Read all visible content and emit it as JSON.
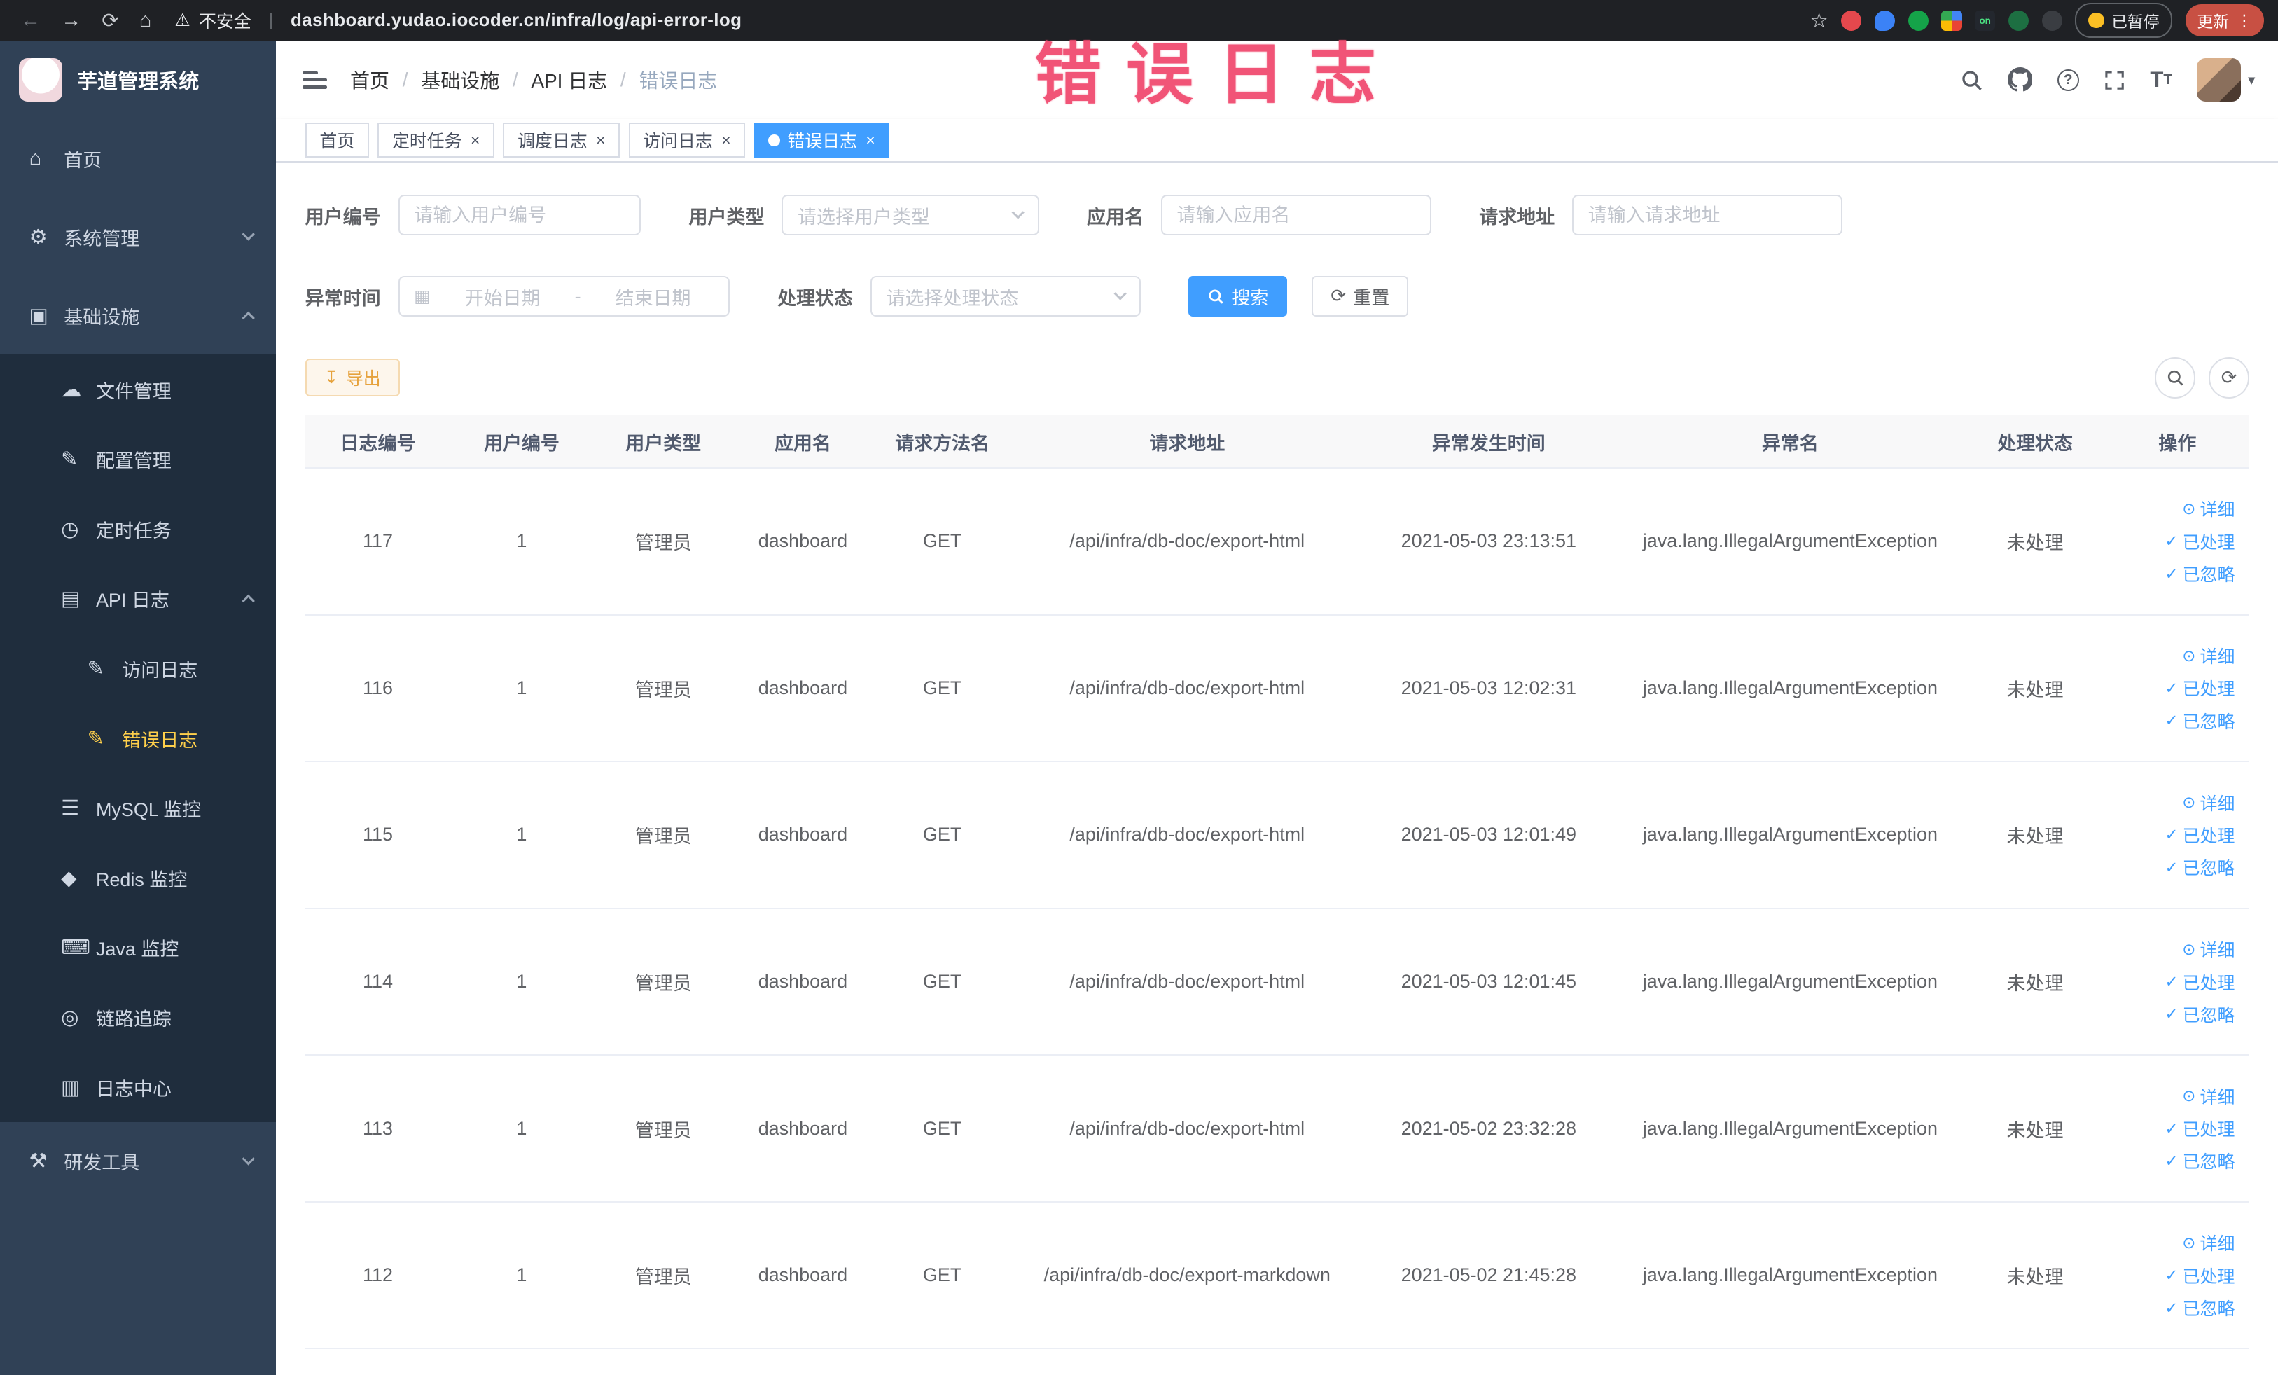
{
  "annotation": {
    "text": "错误日志"
  },
  "browser": {
    "security_label": "不安全",
    "url": "dashboard.yudao.iocoder.cn/infra/log/api-error-log",
    "extension_on_badge": "on",
    "paused_badge": "已暂停",
    "update_button": "更新"
  },
  "icons": {
    "back": "←",
    "forward": "→",
    "reload": "⟳",
    "home": "⌂",
    "warning": "⚠",
    "star": "☆",
    "kebab": "⋮",
    "slash": "/",
    "question": "?",
    "t_large": "T",
    "t_small": "T",
    "caret_down": "▾",
    "close": "×",
    "calendar": "▦",
    "download": "↧",
    "refresh": "⟳",
    "check": "✓",
    "eye": "⊙"
  },
  "sidebar": {
    "app_title": "芋道管理系统",
    "items": [
      {
        "label": "首页",
        "glyph": "⌂",
        "level": 1
      },
      {
        "label": "系统管理",
        "glyph": "⚙",
        "level": 1,
        "expanded": false
      },
      {
        "label": "基础设施",
        "glyph": "▣",
        "level": 1,
        "expanded": true
      },
      {
        "label": "文件管理",
        "glyph": "☁",
        "level": 2
      },
      {
        "label": "配置管理",
        "glyph": "✎",
        "level": 2
      },
      {
        "label": "定时任务",
        "glyph": "◷",
        "level": 2
      },
      {
        "label": "API 日志",
        "glyph": "▤",
        "level": 2,
        "expanded": true
      },
      {
        "label": "访问日志",
        "glyph": "✎",
        "level": 3
      },
      {
        "label": "错误日志",
        "glyph": "✎",
        "level": 3,
        "active": true
      },
      {
        "label": "MySQL 监控",
        "glyph": "☰",
        "level": 2
      },
      {
        "label": "Redis 监控",
        "glyph": "◆",
        "level": 2
      },
      {
        "label": "Java 监控",
        "glyph": "⌨",
        "level": 2
      },
      {
        "label": "链路追踪",
        "glyph": "◎",
        "level": 2
      },
      {
        "label": "日志中心",
        "glyph": "▥",
        "level": 2
      },
      {
        "label": "研发工具",
        "glyph": "⚒",
        "level": 1,
        "expanded": false
      }
    ]
  },
  "header": {
    "breadcrumb": [
      "首页",
      "基础设施",
      "API 日志",
      "错误日志"
    ]
  },
  "tabs": [
    {
      "label": "首页",
      "closable": false,
      "active": false
    },
    {
      "label": "定时任务",
      "closable": true,
      "active": false
    },
    {
      "label": "调度日志",
      "closable": true,
      "active": false
    },
    {
      "label": "访问日志",
      "closable": true,
      "active": false
    },
    {
      "label": "错误日志",
      "closable": true,
      "active": true
    }
  ],
  "filters": {
    "user_id": {
      "label": "用户编号",
      "placeholder": "请输入用户编号"
    },
    "user_type": {
      "label": "用户类型",
      "placeholder": "请选择用户类型"
    },
    "app_name": {
      "label": "应用名",
      "placeholder": "请输入应用名"
    },
    "request_url": {
      "label": "请求地址",
      "placeholder": "请输入请求地址"
    },
    "exception_time": {
      "label": "异常时间",
      "start_placeholder": "开始日期",
      "separator": "-",
      "end_placeholder": "结束日期"
    },
    "process_status": {
      "label": "处理状态",
      "placeholder": "请选择处理状态"
    },
    "search_button": "搜索",
    "reset_button": "重置"
  },
  "toolbar": {
    "export_button": "导出"
  },
  "table": {
    "columns": [
      "日志编号",
      "用户编号",
      "用户类型",
      "应用名",
      "请求方法名",
      "请求地址",
      "异常发生时间",
      "异常名",
      "处理状态",
      "操作"
    ],
    "actions": [
      "详细",
      "已处理",
      "已忽略"
    ],
    "rows": [
      {
        "id": "117",
        "user_id": "1",
        "user_type": "管理员",
        "app": "dashboard",
        "method": "GET",
        "url": "/api/infra/db-doc/export-html",
        "time": "2021-05-03 23:13:51",
        "exception": "java.lang.IllegalArgumentException",
        "status": "未处理"
      },
      {
        "id": "116",
        "user_id": "1",
        "user_type": "管理员",
        "app": "dashboard",
        "method": "GET",
        "url": "/api/infra/db-doc/export-html",
        "time": "2021-05-03 12:02:31",
        "exception": "java.lang.IllegalArgumentException",
        "status": "未处理"
      },
      {
        "id": "115",
        "user_id": "1",
        "user_type": "管理员",
        "app": "dashboard",
        "method": "GET",
        "url": "/api/infra/db-doc/export-html",
        "time": "2021-05-03 12:01:49",
        "exception": "java.lang.IllegalArgumentException",
        "status": "未处理"
      },
      {
        "id": "114",
        "user_id": "1",
        "user_type": "管理员",
        "app": "dashboard",
        "method": "GET",
        "url": "/api/infra/db-doc/export-html",
        "time": "2021-05-03 12:01:45",
        "exception": "java.lang.IllegalArgumentException",
        "status": "未处理"
      },
      {
        "id": "113",
        "user_id": "1",
        "user_type": "管理员",
        "app": "dashboard",
        "method": "GET",
        "url": "/api/infra/db-doc/export-html",
        "time": "2021-05-02 23:32:28",
        "exception": "java.lang.IllegalArgumentException",
        "status": "未处理"
      },
      {
        "id": "112",
        "user_id": "1",
        "user_type": "管理员",
        "app": "dashboard",
        "method": "GET",
        "url": "/api/infra/db-doc/export-markdown",
        "time": "2021-05-02 21:45:28",
        "exception": "java.lang.IllegalArgumentException",
        "status": "未处理"
      }
    ]
  }
}
